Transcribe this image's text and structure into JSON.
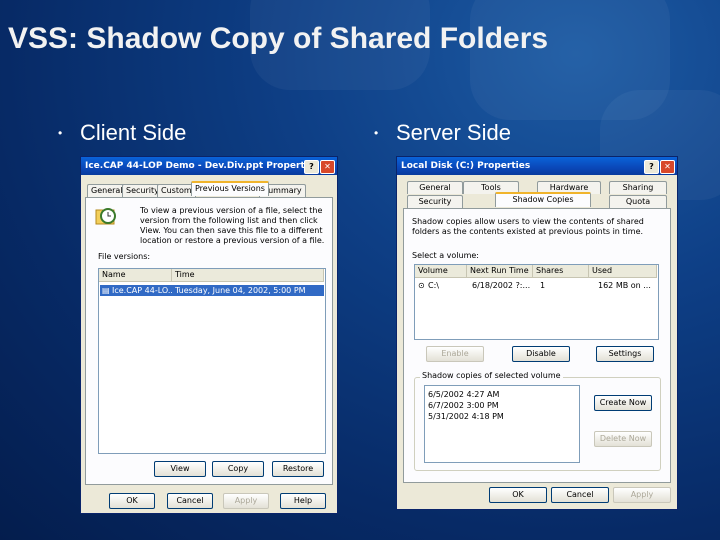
{
  "slide": {
    "title": "VSS: Shadow Copy of Shared Folders",
    "bullets": [
      "Client Side",
      "Server Side"
    ]
  },
  "client_window": {
    "title": "Ice.CAP 44-LOP Demo - Dev.Div.ppt Properties",
    "tabs": [
      "General",
      "Security",
      "Custom",
      "Previous Versions",
      "Summary"
    ],
    "active_tab": "Previous Versions",
    "description": "To view a previous version of a file, select the version from the following list and then click View. You can then save this file to a different location or restore a previous version of a file.",
    "file_versions_label": "File versions:",
    "columns": [
      "Name",
      "Time"
    ],
    "rows": [
      {
        "name": "Ice.CAP 44-LO...",
        "time": "Tuesday, June 04, 2002, 5:00 PM",
        "selected": true
      }
    ],
    "action_buttons": [
      "View",
      "Copy",
      "Restore"
    ],
    "dialog_buttons": [
      "OK",
      "Cancel",
      "Apply",
      "Help"
    ]
  },
  "server_window": {
    "title": "Local Disk (C:) Properties",
    "tabs_row1": [
      "General",
      "Tools",
      "Hardware",
      "Sharing"
    ],
    "tabs_row2": [
      "Security",
      "Shadow Copies",
      "Quota"
    ],
    "active_tab": "Shadow Copies",
    "description": "Shadow copies allow users to view the contents of shared folders as the contents existed at previous points in time.",
    "select_volume_label": "Select a volume:",
    "columns": [
      "Volume",
      "Next Run Time",
      "Shares",
      "Used"
    ],
    "rows": [
      {
        "volume": "C:\\",
        "next_run": "6/18/2002 ?:...",
        "shares": "1",
        "used": "162 MB on ..."
      }
    ],
    "volume_buttons": [
      "Enable",
      "Disable",
      "Settings"
    ],
    "copies_label": "Shadow copies of selected volume",
    "copies": [
      "6/5/2002 4:27 AM",
      "6/7/2002 3:00 PM",
      "5/31/2002 4:18 PM"
    ],
    "copy_buttons": [
      "Create Now",
      "Delete Now"
    ],
    "dialog_buttons": [
      "OK",
      "Cancel",
      "Apply"
    ]
  }
}
